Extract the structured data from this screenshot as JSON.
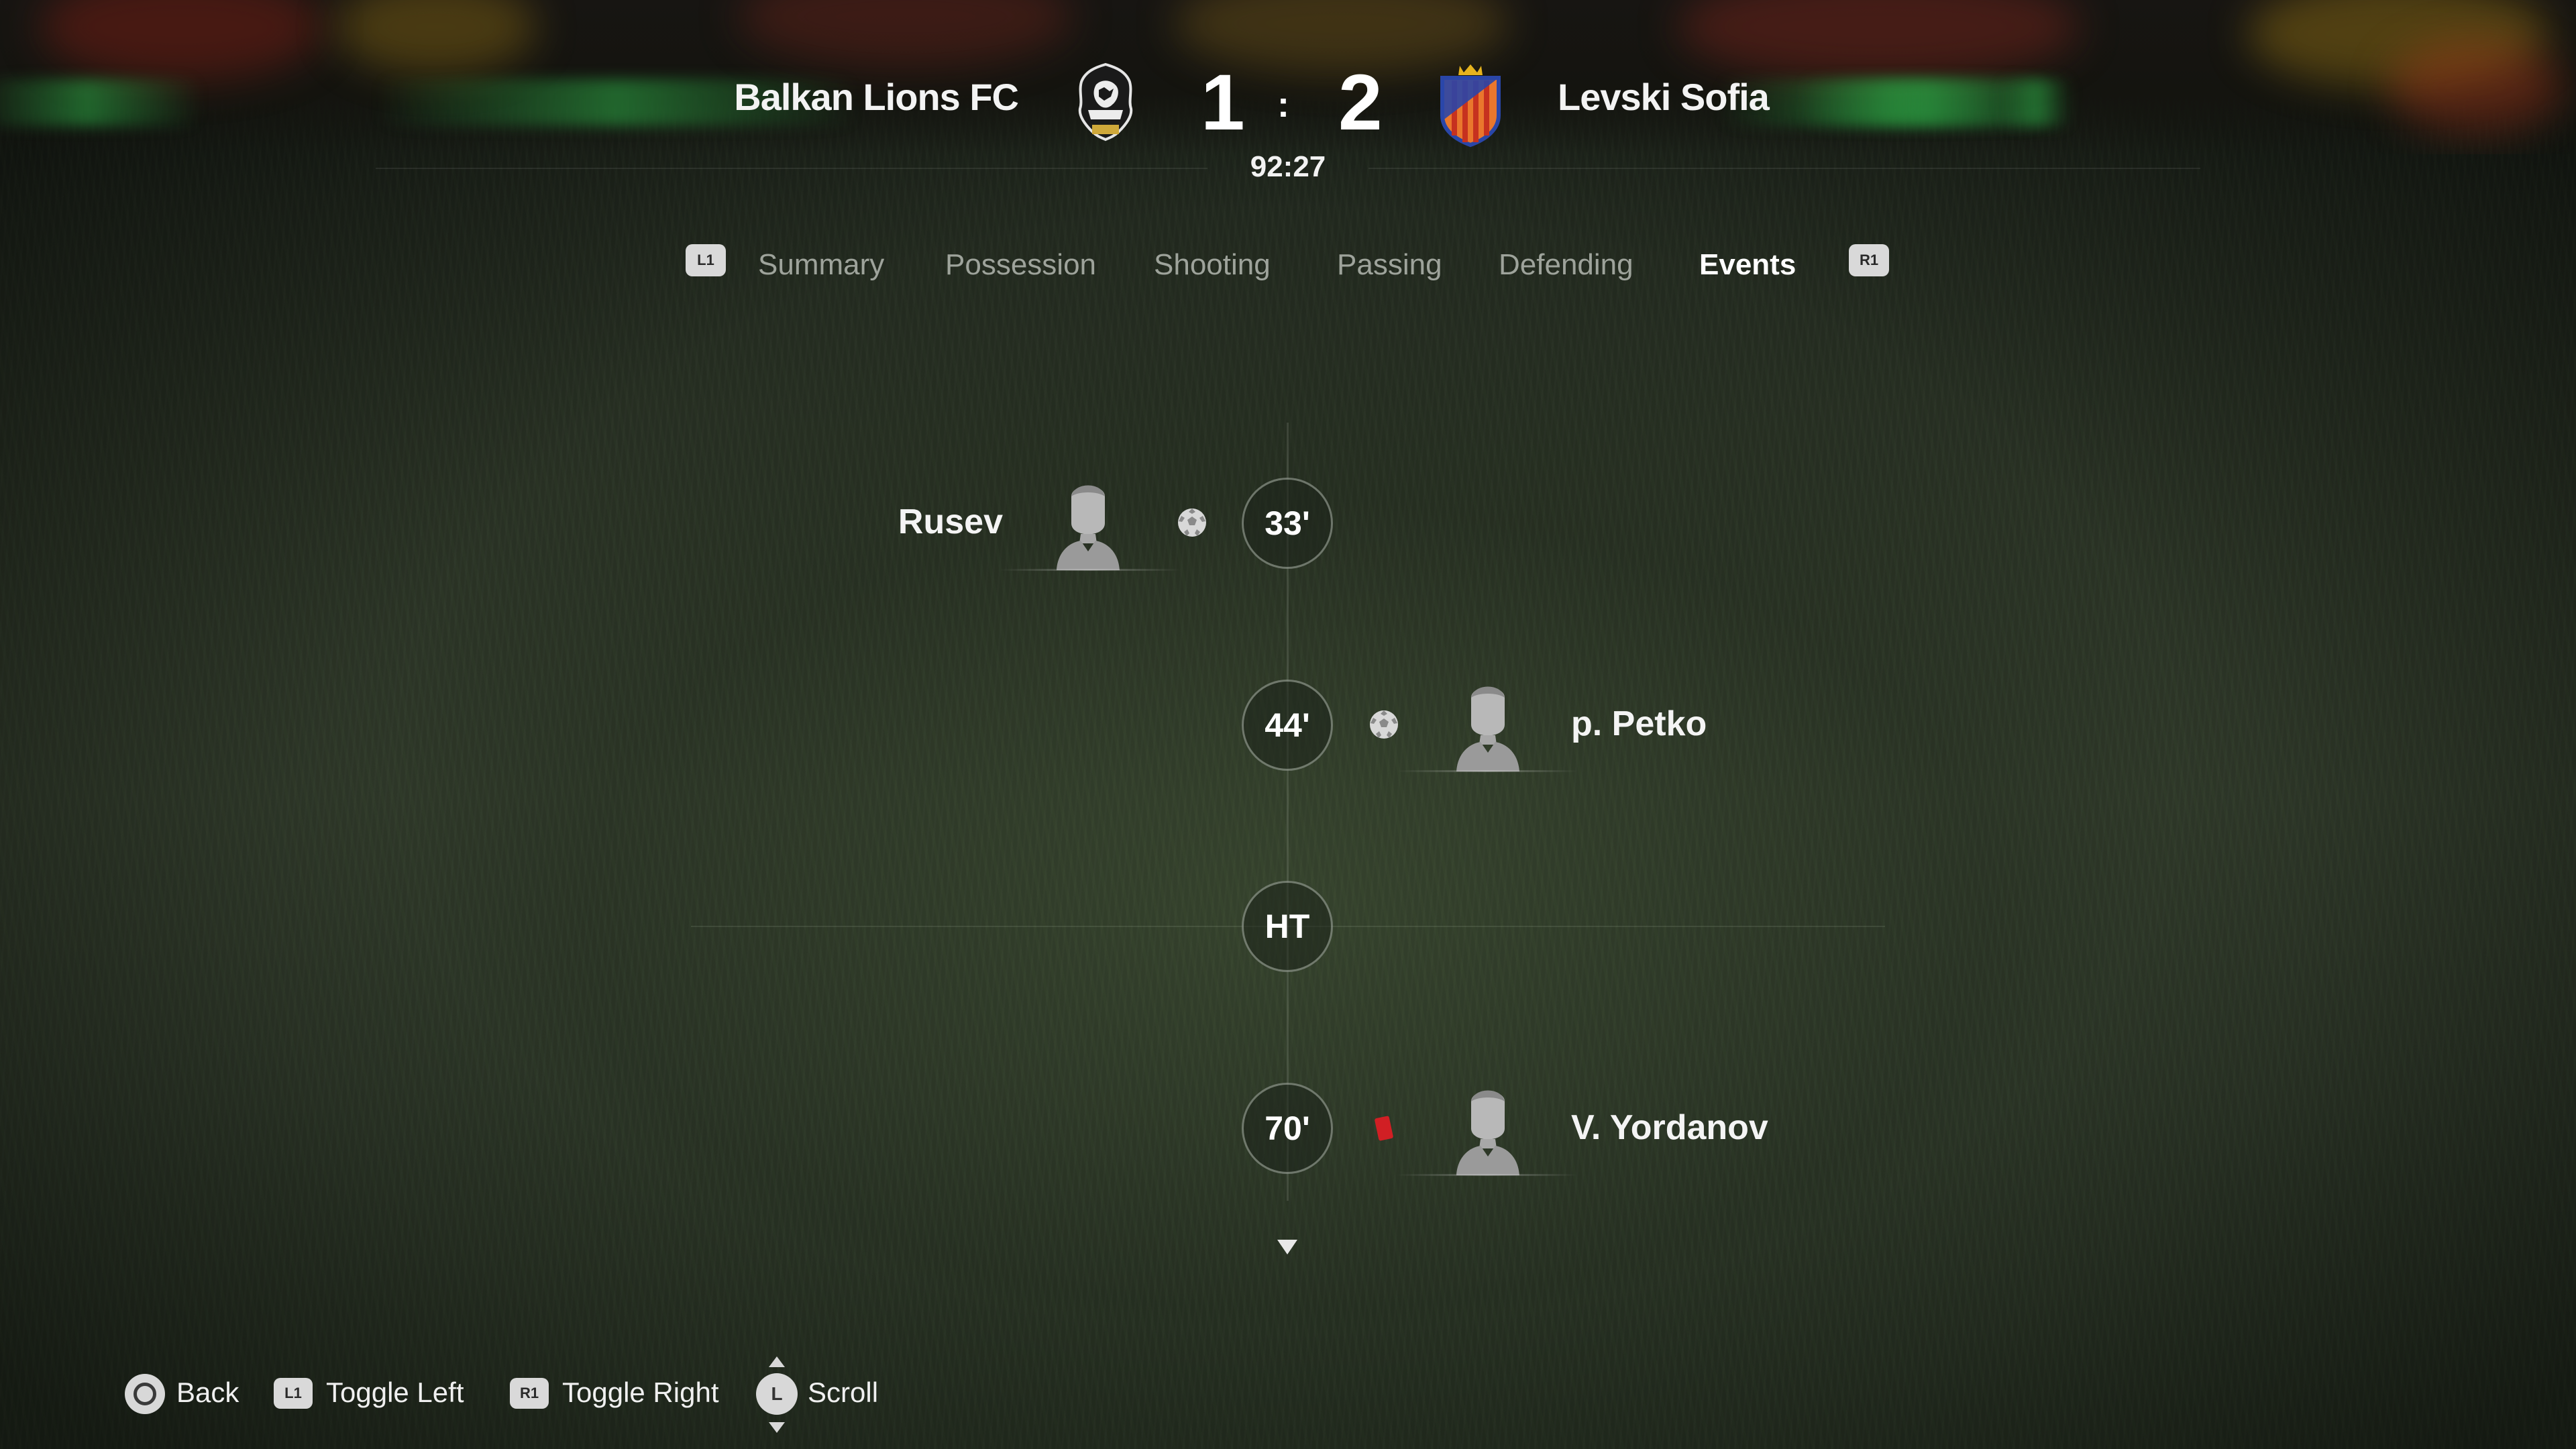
{
  "match": {
    "home_team": "Balkan Lions FC",
    "away_team": "Levski Sofia",
    "home_score": "1",
    "score_separator": ":",
    "away_score": "2",
    "clock": "92:27"
  },
  "tabs": {
    "prev_button": "L1",
    "next_button": "R1",
    "items": [
      {
        "label": "Summary",
        "active": false
      },
      {
        "label": "Possession",
        "active": false
      },
      {
        "label": "Shooting",
        "active": false
      },
      {
        "label": "Passing",
        "active": false
      },
      {
        "label": "Defending",
        "active": false
      },
      {
        "label": "Events",
        "active": true
      }
    ]
  },
  "events": [
    {
      "minute": "33'",
      "side": "home",
      "type": "goal",
      "icon": "soccer-ball-icon",
      "player": "Rusev"
    },
    {
      "minute": "44'",
      "side": "away",
      "type": "goal",
      "icon": "soccer-ball-icon",
      "player": "p. Petko"
    },
    {
      "minute": "HT",
      "side": "center",
      "type": "half-time"
    },
    {
      "minute": "70'",
      "side": "away",
      "type": "red-card",
      "icon": "red-card-icon",
      "player": "V. Yordanov"
    }
  ],
  "footer": {
    "back_label": "Back",
    "toggle_left_button": "L1",
    "toggle_left_label": "Toggle Left",
    "toggle_right_button": "R1",
    "toggle_right_label": "Toggle Right",
    "scroll_button": "L",
    "scroll_label": "Scroll"
  },
  "colors": {
    "accent_text": "#ffffff",
    "inactive_tab": "#9ea39b",
    "red_card": "#d11f24",
    "away_crest_primary": "#e8742a",
    "away_crest_secondary": "#2a46a8"
  }
}
